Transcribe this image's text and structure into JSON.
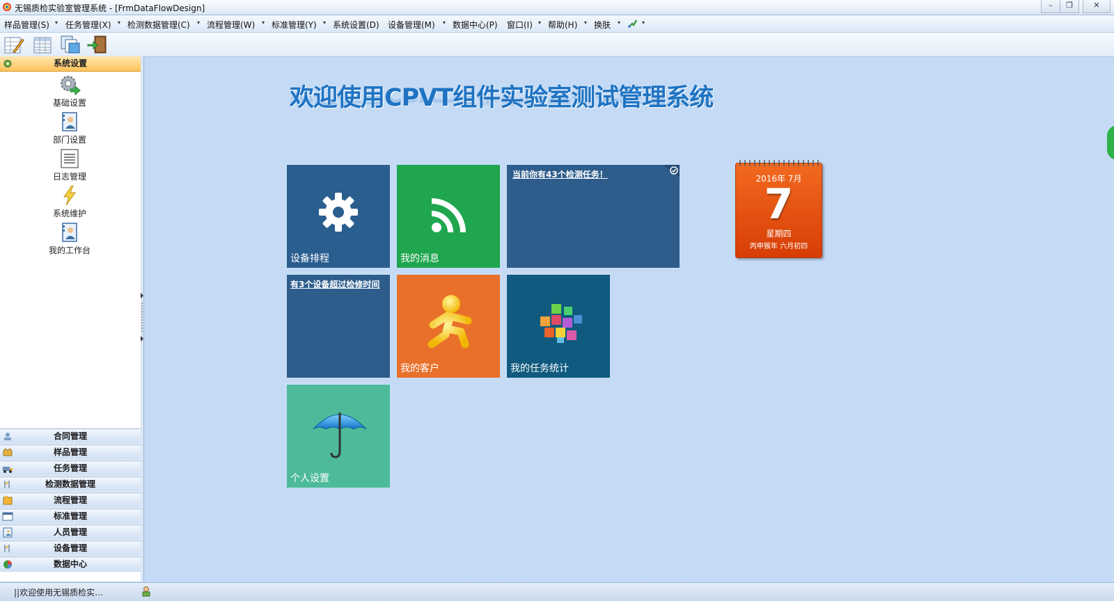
{
  "window": {
    "title": "无锡质检实验室管理系统 - [FrmDataFlowDesign]",
    "buttons": {
      "minimize": "–",
      "restore": "❐",
      "close": "✕"
    }
  },
  "menu": [
    {
      "label": "样品管理(S)",
      "caret": "▾"
    },
    {
      "label": "任务管理(X)",
      "caret": "▾"
    },
    {
      "label": "检测数据管理(C)",
      "caret": "▾"
    },
    {
      "label": "流程管理(W)",
      "caret": "▾"
    },
    {
      "label": "标准管理(Y)",
      "caret": "▾"
    },
    {
      "label": "系统设置(D)",
      "caret": ""
    },
    {
      "label": "设备管理(M)",
      "caret": "▾"
    },
    {
      "label": "数据中心(P)",
      "caret": ""
    },
    {
      "label": "窗口(I)",
      "caret": "▾"
    },
    {
      "label": "帮助(H)",
      "caret": "▾"
    },
    {
      "label": "换肤",
      "caret": "▾"
    },
    {
      "label": "",
      "caret": "▾"
    }
  ],
  "sidebar": {
    "header": "系统设置",
    "items": [
      {
        "label": "基础设置",
        "icon": "gear-arrow-icon"
      },
      {
        "label": "部门设置",
        "icon": "department-icon"
      },
      {
        "label": "日志管理",
        "icon": "log-icon"
      },
      {
        "label": "系统维护",
        "icon": "lightning-icon"
      },
      {
        "label": "我的工作台",
        "icon": "workbench-icon"
      }
    ],
    "sections": [
      {
        "label": "合同管理",
        "icon": "contract-icon"
      },
      {
        "label": "样品管理",
        "icon": "sample-icon"
      },
      {
        "label": "任务管理",
        "icon": "task-icon"
      },
      {
        "label": "检测数据管理",
        "icon": "test-data-icon"
      },
      {
        "label": "流程管理",
        "icon": "flow-icon"
      },
      {
        "label": "标准管理",
        "icon": "standard-icon"
      },
      {
        "label": "人员管理",
        "icon": "personnel-icon"
      },
      {
        "label": "设备管理",
        "icon": "equipment-icon"
      },
      {
        "label": "数据中心",
        "icon": "data-center-icon"
      }
    ]
  },
  "status": {
    "text": "||欢迎使用无锡质检实…"
  },
  "main": {
    "welcome": "欢迎使用CPVT组件实验室测试管理系统",
    "tiles": {
      "schedule": {
        "label": "设备排程",
        "color": "#2a5e8f"
      },
      "messages": {
        "label": "我的消息",
        "color": "#1fa64f"
      },
      "tasks_notice": {
        "text": "当前你有43个检测任务！",
        "color": "#2e5d8c"
      },
      "overdue": {
        "text": "有3个设备超过检修时间",
        "color": "#2e5d8c"
      },
      "customers": {
        "label": "我的客户",
        "color": "#e8702a"
      },
      "task_stats": {
        "label": "我的任务统计",
        "color": "#0f5a7e"
      },
      "personal": {
        "label": "个人设置",
        "color": "#4dbb9a"
      }
    },
    "calendar": {
      "year_month": "2016年  7月",
      "day": "7",
      "weekday": "星期四",
      "lunar": "丙申猴年  六月初四"
    }
  },
  "colors": {
    "background": "#c5dbf5",
    "accent": "#1f73c2",
    "sidebar_header": "#ffc25a"
  }
}
